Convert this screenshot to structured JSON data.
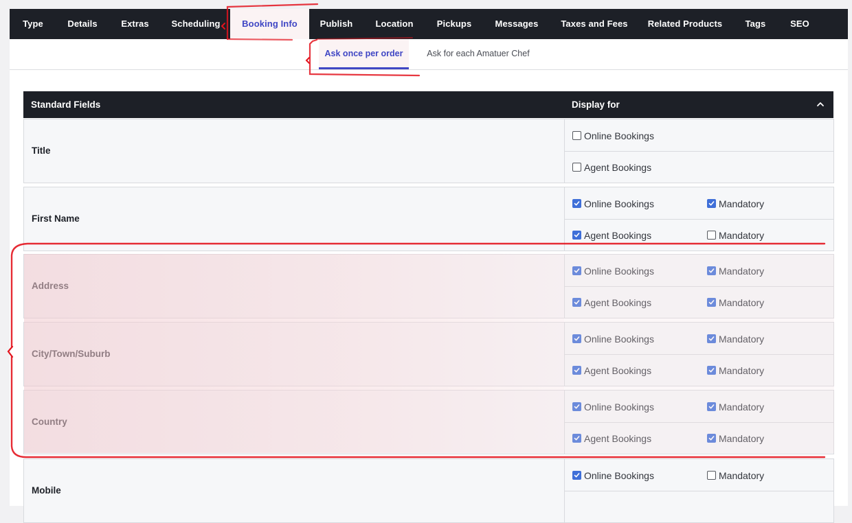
{
  "main_tabs": [
    {
      "label": "Type"
    },
    {
      "label": "Details"
    },
    {
      "label": "Extras"
    },
    {
      "label": "Scheduling"
    },
    {
      "label": "Booking Info",
      "active": true
    },
    {
      "label": "Publish"
    },
    {
      "label": "Location"
    },
    {
      "label": "Pickups"
    },
    {
      "label": "Messages"
    },
    {
      "label": "Taxes and Fees"
    },
    {
      "label": "Related Products"
    },
    {
      "label": "Tags"
    },
    {
      "label": "SEO"
    }
  ],
  "sub_tabs": [
    {
      "label": "Ask once per order",
      "active": true
    },
    {
      "label": "Ask for each Amatuer Chef"
    }
  ],
  "table": {
    "col_standard_fields": "Standard Fields",
    "col_display_for": "Display for"
  },
  "option_labels": {
    "online": "Online Bookings",
    "agent": "Agent Bookings",
    "mandatory": "Mandatory"
  },
  "fields": [
    {
      "name": "Title",
      "online": false,
      "agent": false,
      "online_mandatory": null,
      "agent_mandatory": null
    },
    {
      "name": "First Name",
      "online": true,
      "agent": true,
      "online_mandatory": true,
      "agent_mandatory": false
    },
    {
      "name": "Address",
      "online": true,
      "agent": true,
      "online_mandatory": true,
      "agent_mandatory": true
    },
    {
      "name": "City/Town/Suburb",
      "online": true,
      "agent": true,
      "online_mandatory": true,
      "agent_mandatory": true
    },
    {
      "name": "Country",
      "online": true,
      "agent": true,
      "online_mandatory": true,
      "agent_mandatory": true
    },
    {
      "name": "Mobile",
      "online": true,
      "agent": null,
      "online_mandatory": false,
      "agent_mandatory": null
    }
  ],
  "colors": {
    "dark_bar": "#1d2027",
    "accent": "#3f46c4",
    "checkbox": "#3f6fd8",
    "annotation": "#e3141e"
  }
}
